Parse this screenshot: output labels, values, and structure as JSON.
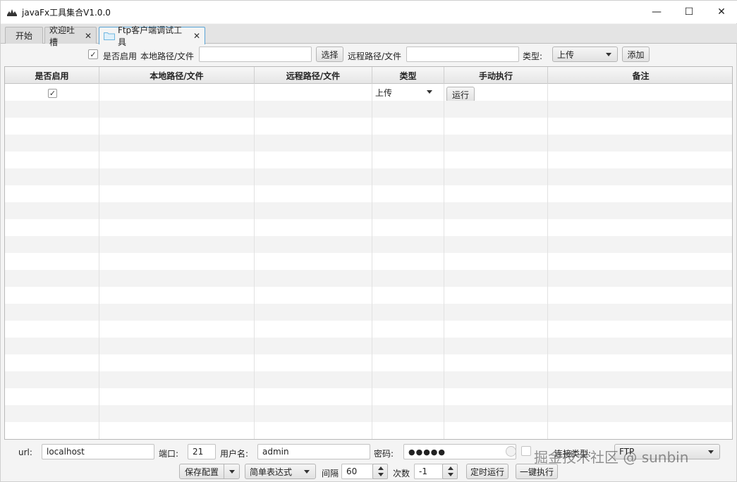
{
  "window": {
    "title": "javaFx工具集合V1.0.0",
    "minimize": "—",
    "maximize": "☐",
    "close": "✕"
  },
  "tabs": [
    {
      "label": "开始",
      "closable": false,
      "active": false
    },
    {
      "label": "欢迎吐槽",
      "closable": true,
      "active": false
    },
    {
      "label": "Ftp客户端调试工具",
      "closable": true,
      "active": true
    }
  ],
  "toolbar": {
    "enabled_label": "是否启用",
    "enabled_checked": "✓",
    "local_path_label": "本地路径/文件",
    "local_path_value": "",
    "choose_button": "选择",
    "remote_path_label": "远程路径/文件",
    "remote_path_value": "",
    "type_label": "类型:",
    "type_value": "上传",
    "add_button": "添加"
  },
  "table": {
    "columns": [
      "是否启用",
      "本地路径/文件",
      "远程路径/文件",
      "类型",
      "手动执行",
      "备注"
    ],
    "rows": [
      {
        "enabled": "✓",
        "local": "",
        "remote": "",
        "type": "上传",
        "action": "运行",
        "note": ""
      }
    ]
  },
  "connection": {
    "url_label": "url:",
    "url_value": "localhost",
    "port_label": "端口:",
    "port_value": "21",
    "user_label": "用户名:",
    "user_value": "admin",
    "password_label": "密码:",
    "password_value": "●●●●●",
    "conn_type_label": "连接类型:",
    "conn_type_value": "FTP"
  },
  "schedule": {
    "save_config": "保存配置",
    "expression_type": "简单表达式",
    "interval_label": "间隔",
    "interval_value": "60",
    "count_label": "次数",
    "count_value": "-1",
    "timed_run": "定时运行",
    "run_all": "一键执行"
  },
  "watermark": "掘金技术社区 @ sunbin",
  "colors": {
    "active_tab_border": "#5aa4d6",
    "folder": "#6fb7e0"
  }
}
